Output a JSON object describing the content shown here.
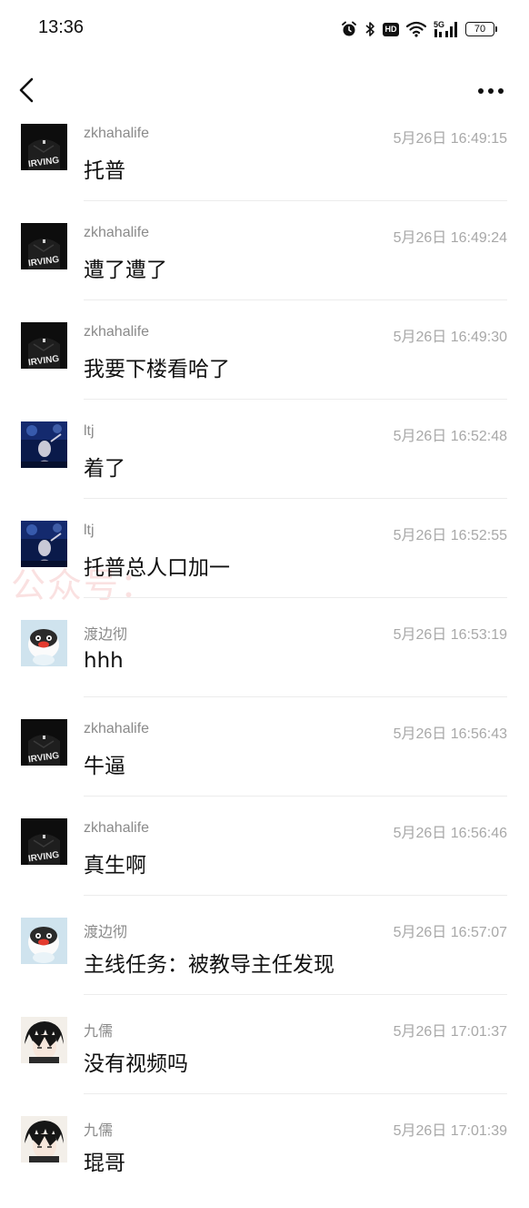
{
  "status_bar": {
    "time": "13:36",
    "network": "5G",
    "hd": "HD",
    "battery": "70"
  },
  "watermark": {
    "text": "公众号："
  },
  "messages": [
    {
      "sender": "zkhahalife",
      "timestamp": "5月26日 16:49:15",
      "text": "托普",
      "avatar": "irving-avatar"
    },
    {
      "sender": "zkhahalife",
      "timestamp": "5月26日 16:49:24",
      "text": "遭了遭了",
      "avatar": "irving-avatar"
    },
    {
      "sender": "zkhahalife",
      "timestamp": "5月26日 16:49:30",
      "text": "我要下楼看哈了",
      "avatar": "irving-avatar"
    },
    {
      "sender": "ltj",
      "timestamp": "5月26日 16:52:48",
      "text": "着了",
      "avatar": "concert-avatar"
    },
    {
      "sender": "ltj",
      "timestamp": "5月26日 16:52:55",
      "text": "托普总人口加一",
      "avatar": "concert-avatar"
    },
    {
      "sender": "渡边彻",
      "timestamp": "5月26日 16:53:19",
      "text": "hhh",
      "avatar": "penguin-avatar"
    },
    {
      "sender": "zkhahalife",
      "timestamp": "5月26日 16:56:43",
      "text": "牛逼",
      "avatar": "irving-avatar"
    },
    {
      "sender": "zkhahalife",
      "timestamp": "5月26日 16:56:46",
      "text": "真生啊",
      "avatar": "irving-avatar"
    },
    {
      "sender": "渡边彻",
      "timestamp": "5月26日 16:57:07",
      "text": "主线任务：被教导主任发现",
      "avatar": "penguin-avatar"
    },
    {
      "sender": "九儒",
      "timestamp": "5月26日 17:01:37",
      "text": "没有视频吗",
      "avatar": "anime-avatar"
    },
    {
      "sender": "九儒",
      "timestamp": "5月26日 17:01:39",
      "text": "琨哥",
      "avatar": "anime-avatar"
    }
  ]
}
